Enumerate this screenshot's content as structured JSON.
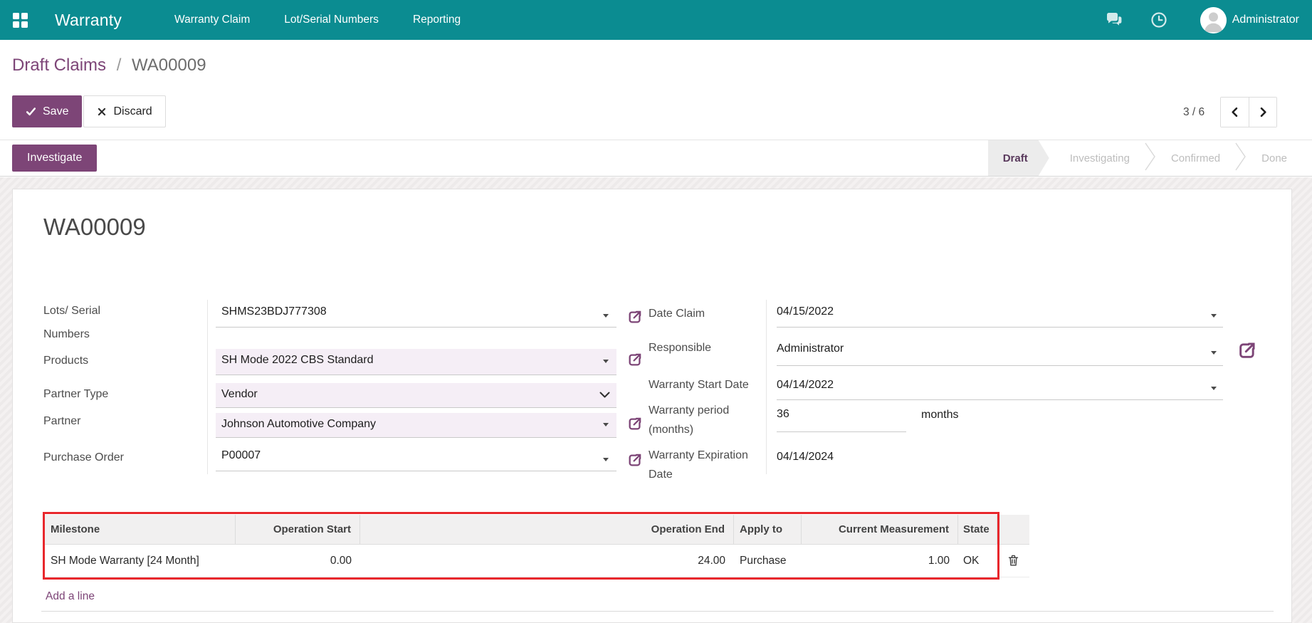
{
  "navbar": {
    "brand": "Warranty",
    "menu_items": [
      {
        "label": "Warranty Claim"
      },
      {
        "label": "Lot/Serial Numbers"
      },
      {
        "label": "Reporting"
      }
    ],
    "user_name": "Administrator"
  },
  "control_panel": {
    "breadcrumb": {
      "parent": "Draft Claims",
      "separator": "/",
      "current": "WA00009"
    },
    "save_label": "Save",
    "discard_label": "Discard",
    "pager_value": "3 / 6"
  },
  "statusbar": {
    "action_label": "Investigate",
    "steps": [
      {
        "label": "Draft",
        "active": true
      },
      {
        "label": "Investigating",
        "active": false
      },
      {
        "label": "Confirmed",
        "active": false
      },
      {
        "label": "Done",
        "active": false
      }
    ]
  },
  "form": {
    "title": "WA00009",
    "fields": {
      "lots_serial": {
        "label": "Lots/ Serial Numbers",
        "value": "SHMS23BDJ777308"
      },
      "products": {
        "label": "Products",
        "value": "SH Mode 2022 CBS Standard"
      },
      "partner_type": {
        "label": "Partner Type",
        "value": "Vendor"
      },
      "partner": {
        "label": "Partner",
        "value": "Johnson Automotive Company"
      },
      "purchase_order": {
        "label": "Purchase Order",
        "value": "P00007"
      },
      "date_claim": {
        "label": "Date Claim",
        "value": "04/15/2022"
      },
      "responsible": {
        "label": "Responsible",
        "value": "Administrator"
      },
      "warranty_start_date": {
        "label": "Warranty Start Date",
        "value": "04/14/2022"
      },
      "warranty_period": {
        "label": "Warranty period (months)",
        "value": "36",
        "unit": "months"
      },
      "warranty_expiration_date": {
        "label": "Warranty Expiration Date",
        "value": "04/14/2024"
      }
    }
  },
  "milestones_table": {
    "columns": [
      "Milestone",
      "Operation Start",
      "Operation End",
      "Apply to",
      "Current Measurement",
      "State"
    ],
    "rows": [
      {
        "milestone": "SH Mode Warranty [24 Month]",
        "operation_start": "0.00",
        "operation_end": "24.00",
        "apply_to": "Purchase",
        "current_measurement": "1.00",
        "state": "OK"
      }
    ],
    "add_line_label": "Add a line"
  },
  "colors": {
    "navbar_bg": "#0b8c91",
    "primary": "#7d4577",
    "highlight_field_bg": "#f5eef6",
    "annotation_red": "#e8272c"
  }
}
